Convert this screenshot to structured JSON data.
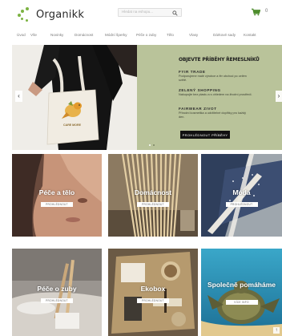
{
  "header": {
    "brand": "Organikk",
    "search_placeholder": "Hledat na eshopu...",
    "cart_count": "0"
  },
  "nav": {
    "items": [
      "Úvod",
      "Vše",
      "Novinky",
      "Domácnost",
      "Módní šperky",
      "Péče o zuby",
      "Tělo",
      "Vlasy",
      "Dárkové sady",
      "Kontakt"
    ]
  },
  "hero": {
    "title": "OBJEVTE PŘÍBĚHY ŘEMESLNÍKŮ",
    "sections": [
      {
        "heading": "FYIR TRADE",
        "text": "Podporujeme malé výrobce a fér obchod po celém světě."
      },
      {
        "heading": "ZELENÝ SHOPPING",
        "text": "Nakupujte bez plastu a s ohledem na životní prostředí."
      },
      {
        "heading": "FAIRWEAR ZIVOT",
        "text": "Přírodní kosmetika a udržitelné doplňky pro každý den."
      }
    ],
    "cta": "PROHLÉDNOUT PŘÍBĚHY",
    "bag_text": "CARE MORE"
  },
  "tiles": [
    {
      "label": "Péče a tělo",
      "button": "PROHLÉDNOUT"
    },
    {
      "label": "Domácnost",
      "button": "PROHLÉDNOUT"
    },
    {
      "label": "Móda",
      "button": "PROHLÉDNOUT"
    },
    {
      "label": "Péče o zuby",
      "button": "PROHLÉDNOUT"
    },
    {
      "label": "Ekobox",
      "button": "PROHLÉDNOUT"
    },
    {
      "label": "Společně pomáháme",
      "button": "VÍCE INFO"
    }
  ],
  "colors": {
    "brand_green": "#7cb342",
    "hero_bg": "#b9c39a",
    "button_dark": "#111111"
  },
  "icons": {
    "search": "search-icon",
    "cart": "cart-icon",
    "prev": "chevron-left-icon",
    "next": "chevron-right-icon",
    "scroll_top": "arrow-up-icon"
  }
}
